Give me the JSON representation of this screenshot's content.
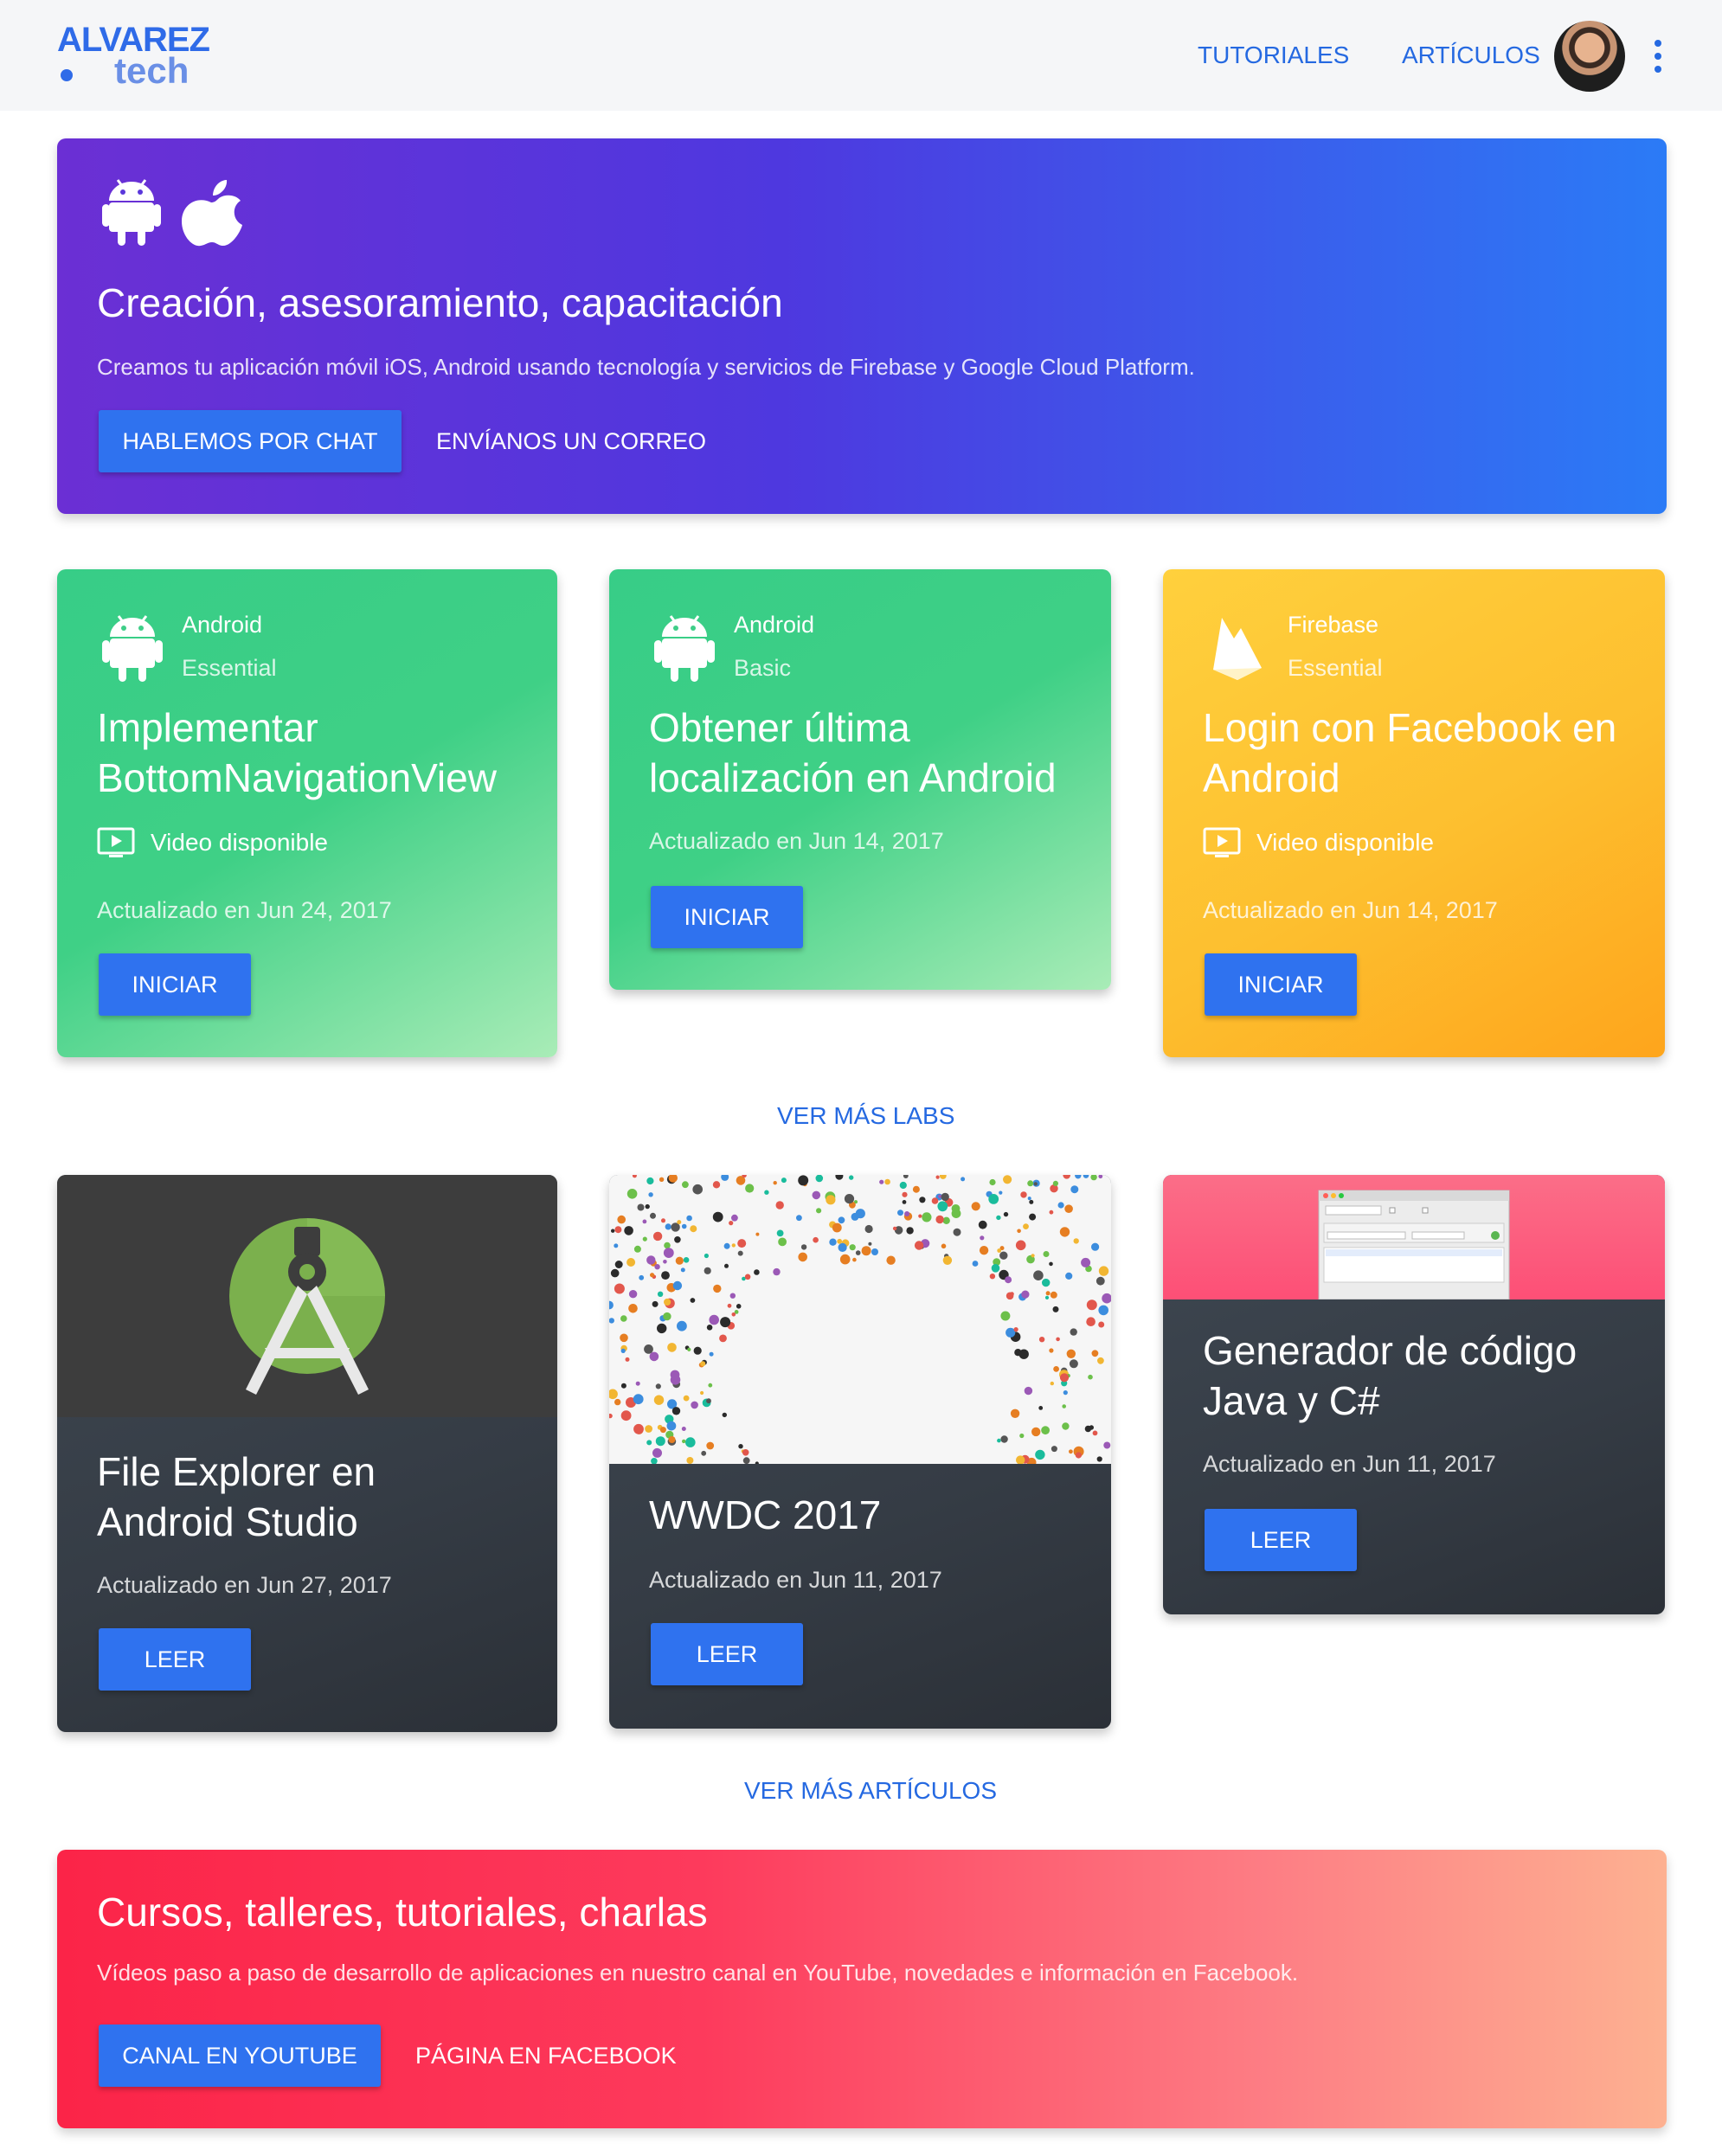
{
  "header": {
    "logo_top": "ALVAREZ",
    "logo_bottom": "tech",
    "nav": [
      {
        "label": "TUTORIALES"
      },
      {
        "label": "ARTÍCULOS"
      }
    ]
  },
  "hero": {
    "title": "Creación, asesoramiento, capacitación",
    "description": "Creamos tu aplicación móvil iOS, Android usando tecnología y servicios de Firebase y Google Cloud Platform.",
    "primary_button": "HABLEMOS POR CHAT",
    "secondary_button": "ENVÍANOS UN CORREO",
    "icons": [
      "android-icon",
      "apple-icon"
    ]
  },
  "labs": [
    {
      "category": "Android",
      "level": "Essential",
      "icon": "android-icon",
      "title_lines": [
        "Implementar",
        "BottomNavigationView"
      ],
      "video": "Video disponible",
      "date": "Actualizado en Jun 24, 2017",
      "button": "INICIAR"
    },
    {
      "category": "Android",
      "level": "Basic",
      "icon": "android-icon",
      "title_lines": [
        "Obtener última",
        "localización en Android"
      ],
      "date": "Actualizado en Jun 14, 2017",
      "button": "INICIAR"
    },
    {
      "category": "Firebase",
      "level": "Essential",
      "icon": "firebase-icon",
      "title_lines": [
        "Login con Facebook en",
        "Android"
      ],
      "video": "Video disponible",
      "date": "Actualizado en Jun 14, 2017",
      "button": "INICIAR"
    }
  ],
  "more_labs": "VER MÁS LABS",
  "articles": [
    {
      "title_lines": [
        "File Explorer en",
        "Android Studio"
      ],
      "date": "Actualizado en Jun 27, 2017",
      "button": "LEER",
      "image": "android-studio-logo"
    },
    {
      "title_lines": [
        "WWDC 2017"
      ],
      "date": "Actualizado en Jun 11, 2017",
      "button": "LEER",
      "image": "wwdc-crowd-image"
    },
    {
      "title_lines": [
        "Generador de código",
        "Java y C#"
      ],
      "date": "Actualizado en Jun 11, 2017",
      "button": "LEER",
      "image": "code-generator-window"
    }
  ],
  "more_articles": "VER MÁS ARTÍCULOS",
  "banner": {
    "title": "Cursos, talleres, tutoriales, charlas",
    "description": "Vídeos paso a paso de desarrollo de aplicaciones en nuestro canal en YouTube, novedades e información en Facebook.",
    "primary_button": "CANAL EN YOUTUBE",
    "secondary_button": "PÁGINA EN FACEBOOK"
  },
  "colors": {
    "accent": "#2f72ef",
    "link": "#2569e1",
    "hero_gradient": [
      "#6b2fd4",
      "#2b7bf6"
    ],
    "green_card": "#37cd87",
    "yellow_card": "#fdbf2f",
    "dark_card": "#3a4149",
    "banner_gradient": [
      "#fb2448",
      "#fdb191"
    ]
  }
}
